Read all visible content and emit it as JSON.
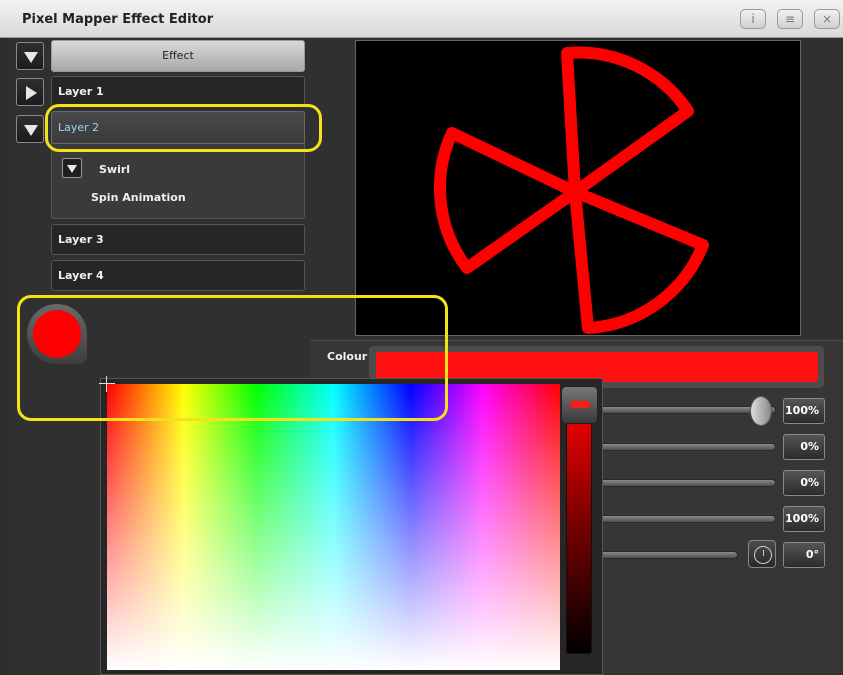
{
  "window": {
    "title": "Pixel Mapper Effect Editor",
    "buttons": {
      "info": "i",
      "menu": "≡",
      "close": "×"
    }
  },
  "tree": {
    "effect_label": "Effect",
    "layers": [
      {
        "label": "Layer 1"
      },
      {
        "label": "Layer 2"
      },
      {
        "label": "Layer 3"
      },
      {
        "label": "Layer 4"
      }
    ],
    "layer2_children": {
      "group_label": "Swirl",
      "item_label": "Spin Animation"
    }
  },
  "preview": {
    "shape_color": "#ff0000",
    "background": "#000000"
  },
  "properties": {
    "colour_label": "Colour",
    "colour_value": "#ff1010",
    "rows": [
      {
        "value": "100%",
        "level": 1.0
      },
      {
        "value": "0%"
      },
      {
        "value": "0%"
      },
      {
        "value": "100%"
      },
      {
        "value": "0°"
      }
    ]
  },
  "picker": {
    "selected_color": "#ff0000",
    "brightness_level": 1.0
  },
  "icons": {
    "expand": "chevron-down-icon",
    "collapse": "chevron-right-icon",
    "rotation": "clock-icon"
  },
  "colors": {
    "accent_highlight": "#f3e21a",
    "layer_selected_text": "#9fd2f2"
  }
}
